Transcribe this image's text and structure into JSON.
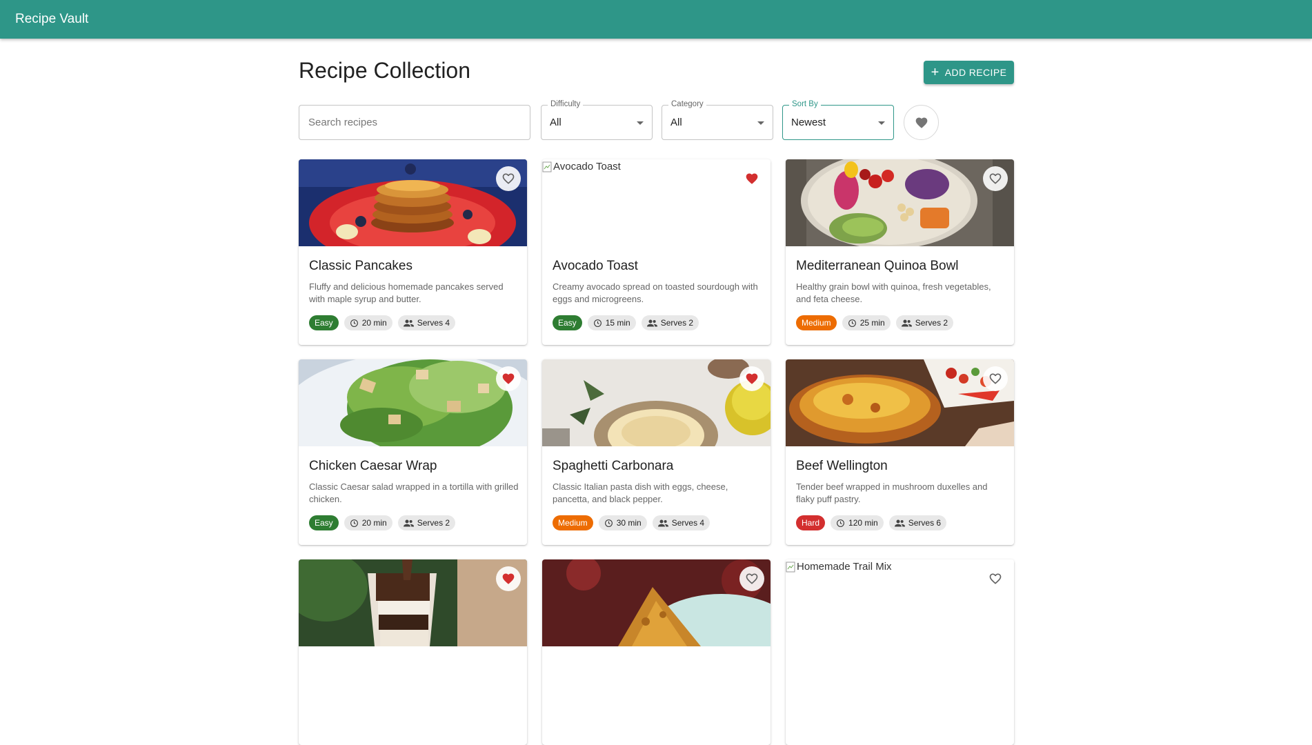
{
  "app": {
    "title": "Recipe Vault"
  },
  "page": {
    "title": "Recipe Collection",
    "add_button_label": "ADD RECIPE"
  },
  "filters": {
    "search_placeholder": "Search recipes",
    "difficulty": {
      "label": "Difficulty",
      "value": "All"
    },
    "category": {
      "label": "Category",
      "value": "All"
    },
    "sort": {
      "label": "Sort By",
      "value": "Newest"
    }
  },
  "recipes": [
    {
      "title": "Classic Pancakes",
      "description": "Fluffy and delicious homemade pancakes served with maple syrup and butter.",
      "difficulty": "Easy",
      "time": "20 min",
      "serves": "Serves 4",
      "favorite": false,
      "image_alt": ""
    },
    {
      "title": "Avocado Toast",
      "description": "Creamy avocado spread on toasted sourdough with eggs and microgreens.",
      "difficulty": "Easy",
      "time": "15 min",
      "serves": "Serves 2",
      "favorite": true,
      "image_alt": "Avocado Toast"
    },
    {
      "title": "Mediterranean Quinoa Bowl",
      "description": "Healthy grain bowl with quinoa, fresh vegetables, and feta cheese.",
      "difficulty": "Medium",
      "time": "25 min",
      "serves": "Serves 2",
      "favorite": false,
      "image_alt": ""
    },
    {
      "title": "Chicken Caesar Wrap",
      "description": "Classic Caesar salad wrapped in a tortilla with grilled chicken.",
      "difficulty": "Easy",
      "time": "20 min",
      "serves": "Serves 2",
      "favorite": true,
      "image_alt": ""
    },
    {
      "title": "Spaghetti Carbonara",
      "description": "Classic Italian pasta dish with eggs, cheese, pancetta, and black pepper.",
      "difficulty": "Medium",
      "time": "30 min",
      "serves": "Serves 4",
      "favorite": true,
      "image_alt": ""
    },
    {
      "title": "Beef Wellington",
      "description": "Tender beef wrapped in mushroom duxelles and flaky puff pastry.",
      "difficulty": "Hard",
      "time": "120 min",
      "serves": "Serves 6",
      "favorite": false,
      "image_alt": ""
    },
    {
      "title": "",
      "description": "",
      "difficulty": "",
      "time": "",
      "serves": "",
      "favorite": true,
      "image_alt": ""
    },
    {
      "title": "",
      "description": "",
      "difficulty": "",
      "time": "",
      "serves": "",
      "favorite": false,
      "image_alt": ""
    },
    {
      "title": "",
      "description": "",
      "difficulty": "",
      "time": "",
      "serves": "",
      "favorite": false,
      "image_alt": "Homemade Trail Mix"
    }
  ],
  "icons": {
    "add": "plus-icon",
    "favorite_filter": "heart-icon",
    "time": "clock-icon",
    "serves": "people-icon",
    "broken_image": "broken-image-icon"
  },
  "colors": {
    "primary": "#2e9688",
    "favorite": "#d32f2f",
    "easy": "#2e7d32",
    "medium": "#ed6c02",
    "hard": "#d32f2f"
  }
}
